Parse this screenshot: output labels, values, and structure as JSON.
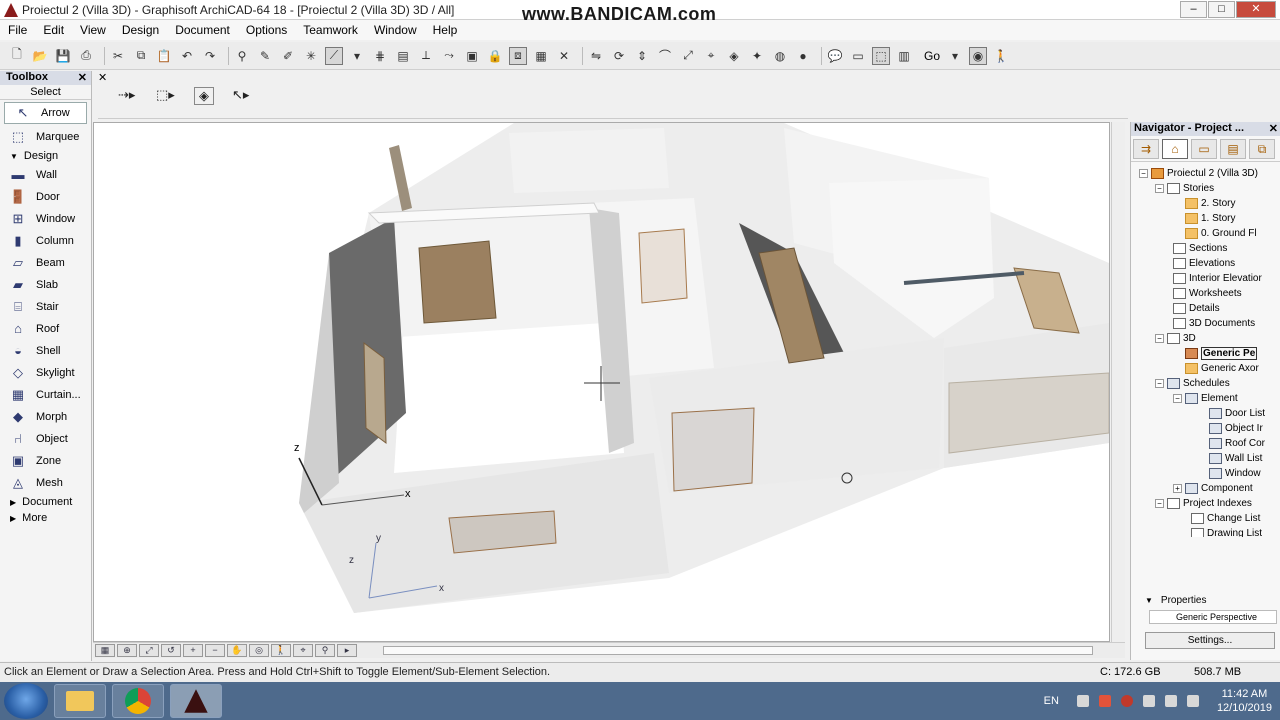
{
  "window": {
    "title": "Proiectul 2 (Villa 3D) - Graphisoft ArchiCAD-64 18 - [Proiectul 2 (Villa 3D) 3D / All]",
    "watermark": "www.BANDICAM.com",
    "minimize": "–",
    "maximize": "□",
    "close": "✕"
  },
  "menu": [
    "File",
    "Edit",
    "View",
    "Design",
    "Document",
    "Options",
    "Teamwork",
    "Window",
    "Help"
  ],
  "toolbar": {
    "go_label": "Go"
  },
  "toolbox": {
    "title": "Toolbox",
    "close": "✕",
    "select_label": "Select",
    "arrow": "Arrow",
    "marquee": "Marquee",
    "design_group": "Design",
    "tools": [
      "Wall",
      "Door",
      "Window",
      "Column",
      "Beam",
      "Slab",
      "Stair",
      "Roof",
      "Shell",
      "Skylight",
      "Curtain...",
      "Morph",
      "Object",
      "Zone",
      "Mesh"
    ],
    "document_group": "Document",
    "more_group": "More"
  },
  "viewport": {
    "axis_x": "x",
    "axis_y": "y",
    "axis_z": "z"
  },
  "navigator": {
    "title": "Navigator - Project ...",
    "close": "✕",
    "tree": {
      "project": "Proiectul 2 (Villa 3D)",
      "stories": "Stories",
      "story2": "2. Story",
      "story1": "1. Story",
      "story0": "0. Ground Fl",
      "sections": "Sections",
      "elevations": "Elevations",
      "interior": "Interior Elevatior",
      "worksheets": "Worksheets",
      "details": "Details",
      "docs3d": "3D Documents",
      "threeD": "3D",
      "generic_pe": "Generic Pe",
      "generic_axon": "Generic Axor",
      "schedules": "Schedules",
      "element": "Element",
      "door_list": "Door List",
      "object_in": "Object Ir",
      "roof_cor": "Roof Cor",
      "wall_list": "Wall List",
      "window": "Window",
      "component": "Component",
      "project_indexes": "Project Indexes",
      "change_list": "Change List",
      "drawing_list": "Drawing List"
    },
    "properties": {
      "header": "Properties",
      "value": "Generic Perspective",
      "settings": "Settings..."
    }
  },
  "status": {
    "message": "Click an Element or Draw a Selection Area. Press and Hold Ctrl+Shift to Toggle Element/Sub-Element Selection.",
    "disk": "C: 172.6 GB",
    "memory": "508.7 MB"
  },
  "taskbar": {
    "lang": "EN",
    "time": "11:42 AM",
    "date": "12/10/2019"
  }
}
